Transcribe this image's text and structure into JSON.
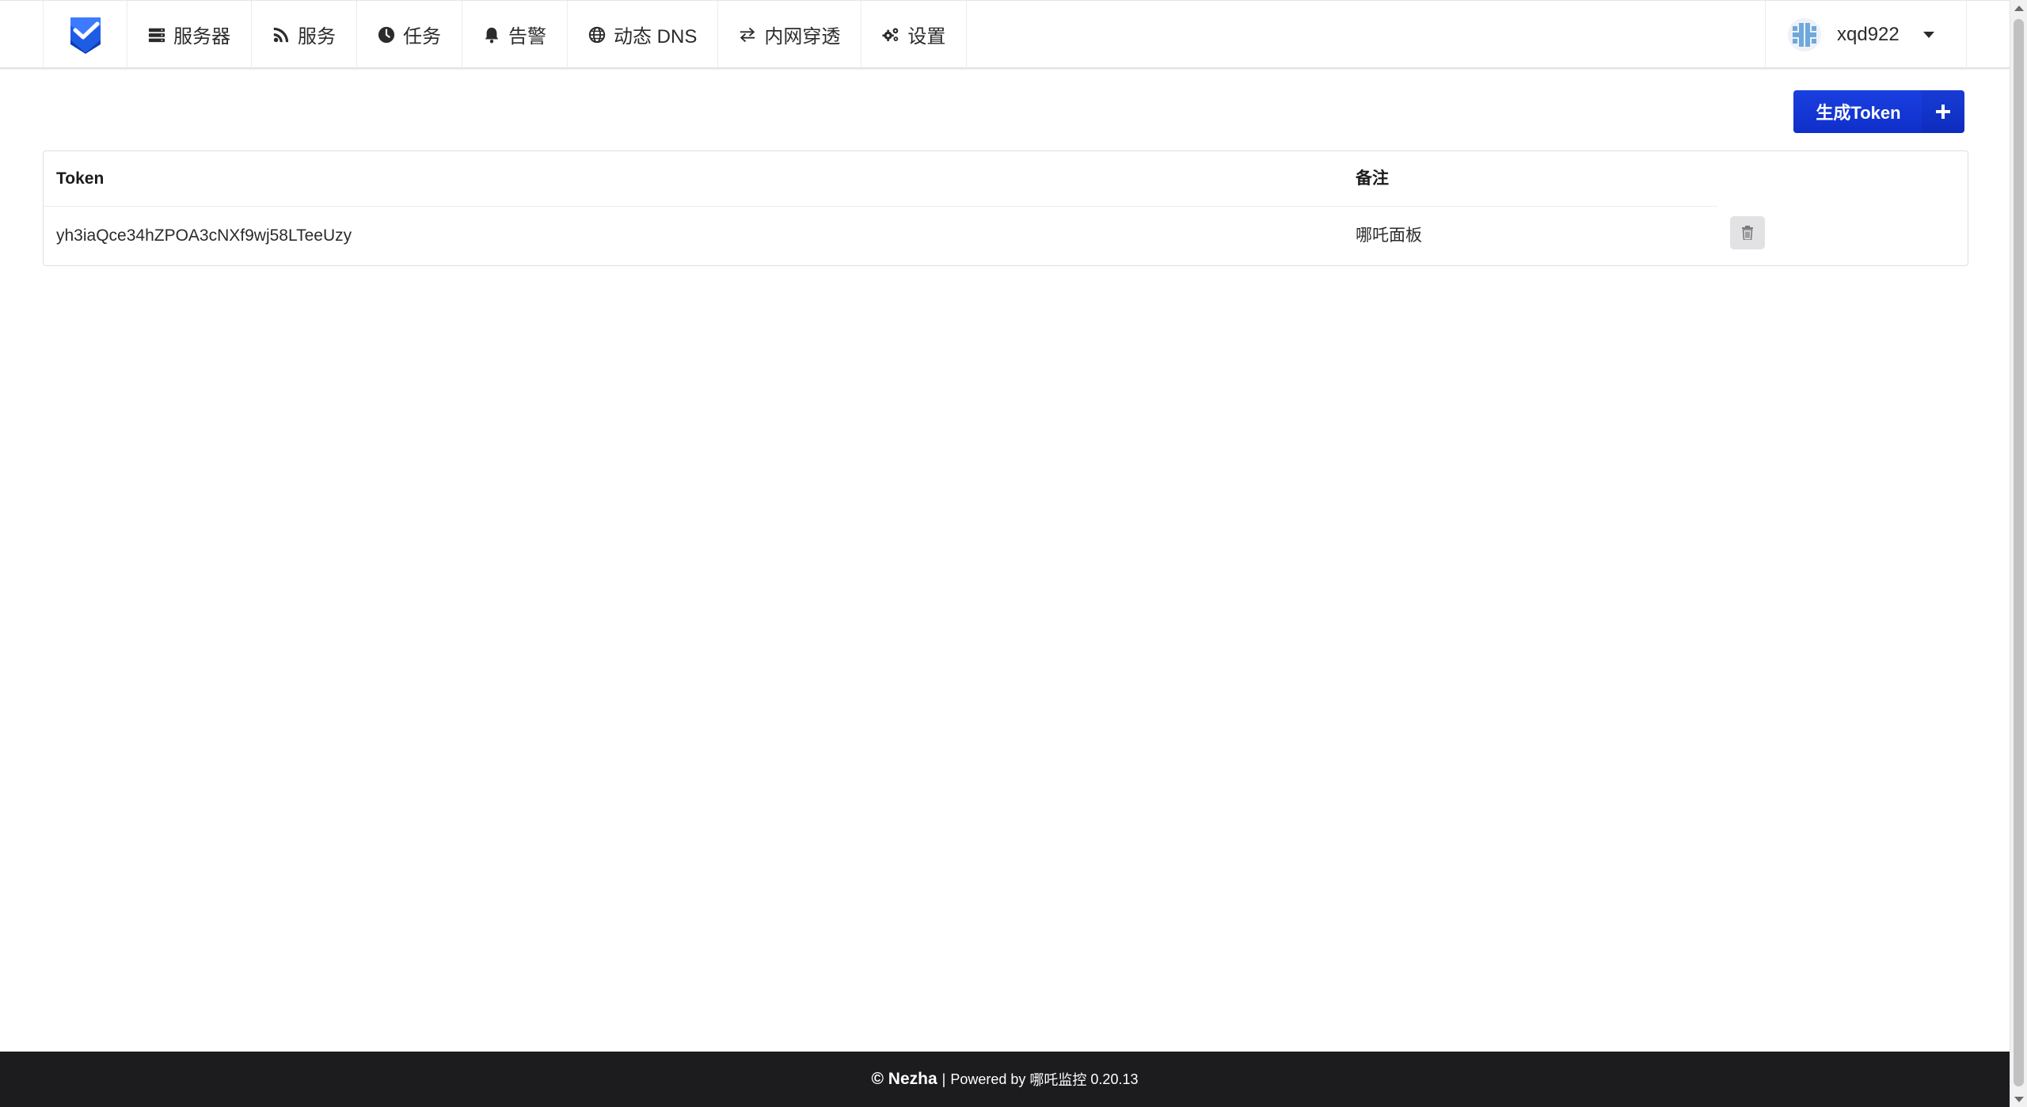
{
  "nav": {
    "logo_icon": "nezha-shield-check-logo",
    "items": [
      {
        "label": "服务器",
        "icon": "server-icon"
      },
      {
        "label": "服务",
        "icon": "rss-icon"
      },
      {
        "label": "任务",
        "icon": "clock-icon"
      },
      {
        "label": "告警",
        "icon": "bell-icon"
      },
      {
        "label": "动态 DNS",
        "icon": "globe-icon"
      },
      {
        "label": "内网穿透",
        "icon": "exchange-icon"
      },
      {
        "label": "设置",
        "icon": "cogs-icon"
      }
    ],
    "user": {
      "name": "xqd922",
      "icon": "avatar"
    }
  },
  "actions": {
    "generate_token_label": "生成Token",
    "generate_token_icon": "plus-icon"
  },
  "table": {
    "columns": [
      "Token",
      "备注"
    ],
    "rows": [
      {
        "token": "yh3iaQce34hZPOA3cNXf9wj58LTeeUzy",
        "note": "哪吒面板",
        "action_icon": "trash-icon"
      }
    ]
  },
  "footer": {
    "brand": "© Nezha",
    "separator": "|",
    "powered_by": "Powered by",
    "product": "哪吒监控",
    "version": "0.20.13"
  },
  "colors": {
    "primary": "#1437d9",
    "footer_bg": "#1c1c1e",
    "logo_blue": "#1e5ce6"
  }
}
